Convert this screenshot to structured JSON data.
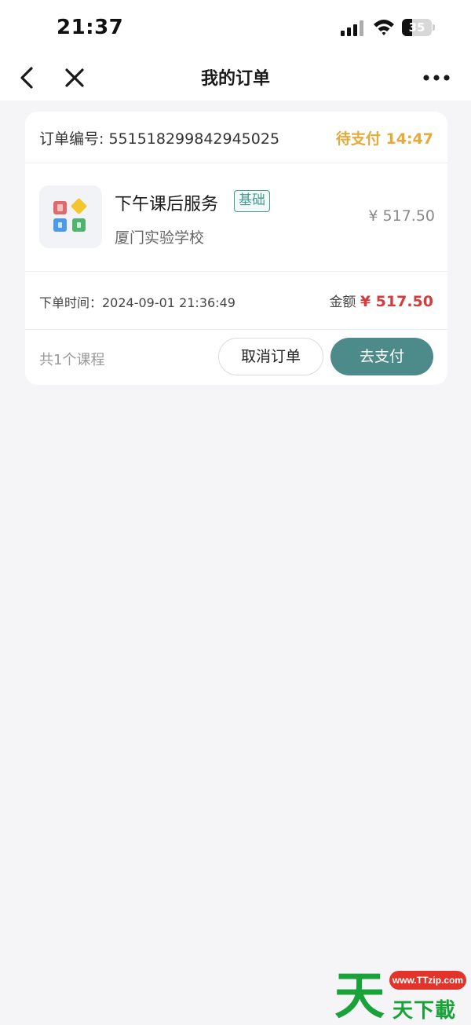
{
  "status_bar": {
    "time": "21:37",
    "battery_level": "35",
    "battery_fraction": 0.35
  },
  "nav": {
    "title": "我的订单",
    "back_icon": "chevron-left-icon",
    "close_icon": "close-icon",
    "more_icon": "more-icon"
  },
  "order": {
    "number_label": "订单编号: 551518299842945025",
    "status": "待支付 14:47",
    "course": {
      "title": "下午课后服务",
      "tag": "基础",
      "school": "厦门实验学校",
      "price": "¥ 517.50"
    },
    "order_time": "下单时间：2024-09-01 21:36:49",
    "amount_label": "金额",
    "amount_value": "¥ 517.50",
    "course_count": "共1个课程",
    "cancel_label": "取消订单",
    "pay_label": "去支付"
  },
  "watermark": {
    "url": "www.TTzip.com",
    "text": "天下載",
    "logo_char": "天"
  },
  "colors": {
    "status_orange": "#e7a93a",
    "price_red": "#d83b3b",
    "pay_button": "#4d8a8a",
    "tag_teal": "#4a9a92",
    "background": "#f5f5f7"
  }
}
